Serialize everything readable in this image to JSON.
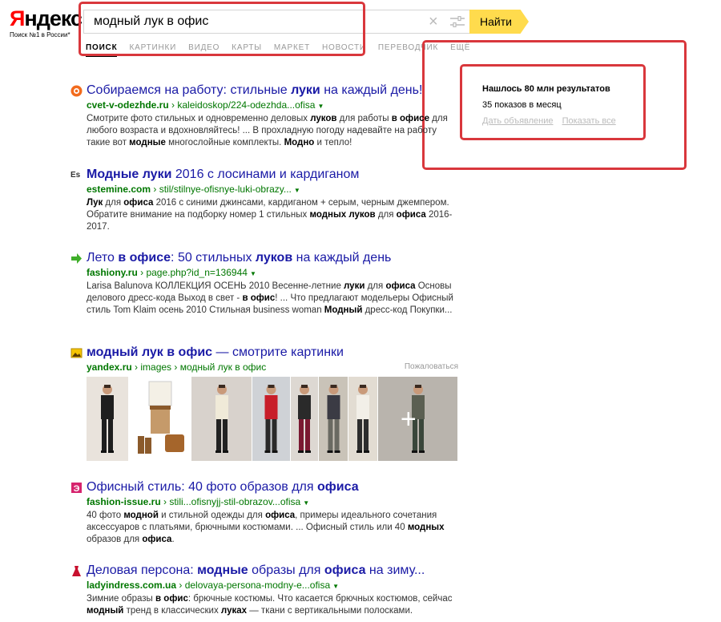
{
  "logo": {
    "first_letter": "Я",
    "rest": "ндекс",
    "tagline": "Поиск №1 в России*"
  },
  "search": {
    "query": "модный лук в офис",
    "button_label": "Найти",
    "clear_glyph": "×"
  },
  "nav": {
    "items": [
      "ПОИСК",
      "КАРТИНКИ",
      "ВИДЕО",
      "КАРТЫ",
      "МАРКЕТ",
      "НОВОСТИ",
      "ПЕРЕВОДЧИК",
      "ЕЩЁ"
    ],
    "active_index": 0
  },
  "info": {
    "count": "Нашлось 80 млн результатов",
    "shows": "35 показов в месяц",
    "ad_link": "Дать объявление",
    "show_all_link": "Показать все"
  },
  "results": [
    {
      "icon": "orange-circle-icon",
      "title_parts": [
        {
          "t": "Собираемся на работу: стильные ",
          "b": false
        },
        {
          "t": "луки",
          "b": true
        },
        {
          "t": " на каждый день!",
          "b": false
        }
      ],
      "url_domain": "cvet-v-odezhde.ru",
      "url_path": "kaleidoskop/224-odezhda...ofisa",
      "snippet": [
        {
          "t": "Смотрите фото стильных и одновременно деловых ",
          "b": false
        },
        {
          "t": "луков",
          "b": true
        },
        {
          "t": " для работы ",
          "b": false
        },
        {
          "t": "в офисе",
          "b": true
        },
        {
          "t": " для любого возраста и вдохновляйтесь! ... В прохладную погоду надевайте на работу такие вот ",
          "b": false
        },
        {
          "t": "модные",
          "b": true
        },
        {
          "t": " многослойные комплекты. ",
          "b": false
        },
        {
          "t": "Модно",
          "b": true
        },
        {
          "t": " и тепло!",
          "b": false
        }
      ]
    },
    {
      "icon": "es-letters-icon",
      "icon_text": "Es",
      "title_parts": [
        {
          "t": "Модные луки",
          "b": true
        },
        {
          "t": " 2016 с лосинами и кардиганом",
          "b": false
        }
      ],
      "url_domain": "estemine.com",
      "url_path": "stil/stilnye-ofisnye-luki-obrazy...",
      "snippet": [
        {
          "t": "Лук",
          "b": true
        },
        {
          "t": " для ",
          "b": false
        },
        {
          "t": "офиса",
          "b": true
        },
        {
          "t": " 2016 с синими джинсами, кардиганом + серым, черным джемпером. Обратите внимание на подборку номер 1 стильных ",
          "b": false
        },
        {
          "t": "модных луков",
          "b": true
        },
        {
          "t": " для ",
          "b": false
        },
        {
          "t": "офиса",
          "b": true
        },
        {
          "t": " 2016-2017.",
          "b": false
        }
      ]
    },
    {
      "icon": "green-arrow-icon",
      "title_parts": [
        {
          "t": "Лето ",
          "b": false
        },
        {
          "t": "в офисе",
          "b": true
        },
        {
          "t": ": 50 стильных ",
          "b": false
        },
        {
          "t": "луков",
          "b": true
        },
        {
          "t": " на каждый день",
          "b": false
        }
      ],
      "url_domain": "fashiony.ru",
      "url_path": "page.php?id_n=136944",
      "snippet": [
        {
          "t": "Larisa Balunova КОЛЛЕКЦИЯ ОСЕНЬ 2010 Весенне-летние ",
          "b": false
        },
        {
          "t": "луки",
          "b": true
        },
        {
          "t": " для ",
          "b": false
        },
        {
          "t": "офиса",
          "b": true
        },
        {
          "t": " Основы делового дресс-кода Выход в свет - ",
          "b": false
        },
        {
          "t": "в офис",
          "b": true
        },
        {
          "t": "! ... Что предлагают модельеры Офисный стиль Tom Klaim осень 2010 Стильная business woman ",
          "b": false
        },
        {
          "t": "Модный",
          "b": true
        },
        {
          "t": " дресс-код Покупки...",
          "b": false
        }
      ]
    },
    {
      "icon": "image-gallery-icon",
      "title_parts": [
        {
          "t": "модный лук в офис",
          "b": true
        },
        {
          "t": " — смотрите картинки",
          "b": false
        }
      ],
      "url_domain": "yandex.ru",
      "url_path": "images",
      "url_tail": "модный лук в офис",
      "report": "Пожаловаться"
    },
    {
      "icon": "fashion-issue-icon",
      "title_parts": [
        {
          "t": "Офисный стиль: 40 фото образов для ",
          "b": false
        },
        {
          "t": "офиса",
          "b": true
        }
      ],
      "url_domain": "fashion-issue.ru",
      "url_path": "stili...ofisnyjj-stil-obrazov...ofisa",
      "snippet": [
        {
          "t": "40 фото ",
          "b": false
        },
        {
          "t": "модной",
          "b": true
        },
        {
          "t": " и стильной одежды для ",
          "b": false
        },
        {
          "t": "офиса",
          "b": true
        },
        {
          "t": ", примеры идеального сочетания аксессуаров с платьями, брючными костюмами. ... Офисный стиль или 40 ",
          "b": false
        },
        {
          "t": "модных",
          "b": true
        },
        {
          "t": " образов для ",
          "b": false
        },
        {
          "t": "офиса",
          "b": true
        },
        {
          "t": ".",
          "b": false
        }
      ]
    },
    {
      "icon": "red-dress-icon",
      "title_parts": [
        {
          "t": "Деловая персона: ",
          "b": false
        },
        {
          "t": "модные",
          "b": true
        },
        {
          "t": " образы для ",
          "b": false
        },
        {
          "t": "офиса",
          "b": true
        },
        {
          "t": " на зиму...",
          "b": false
        }
      ],
      "url_domain": "ladyindress.com.ua",
      "url_path": "delovaya-persona-modny-e...ofisa",
      "snippet": [
        {
          "t": "Зимние образы ",
          "b": false
        },
        {
          "t": "в офис",
          "b": true
        },
        {
          "t": ": брючные костюмы. Что касается брючных костюмов, сейчас ",
          "b": false
        },
        {
          "t": "модный",
          "b": true
        },
        {
          "t": " тренд в классических ",
          "b": false
        },
        {
          "t": "луках",
          "b": true
        },
        {
          "t": " — ткани с вертикальными полосками.",
          "b": false
        }
      ]
    }
  ],
  "gallery": {
    "count": 8,
    "plus_glyph": "+"
  }
}
